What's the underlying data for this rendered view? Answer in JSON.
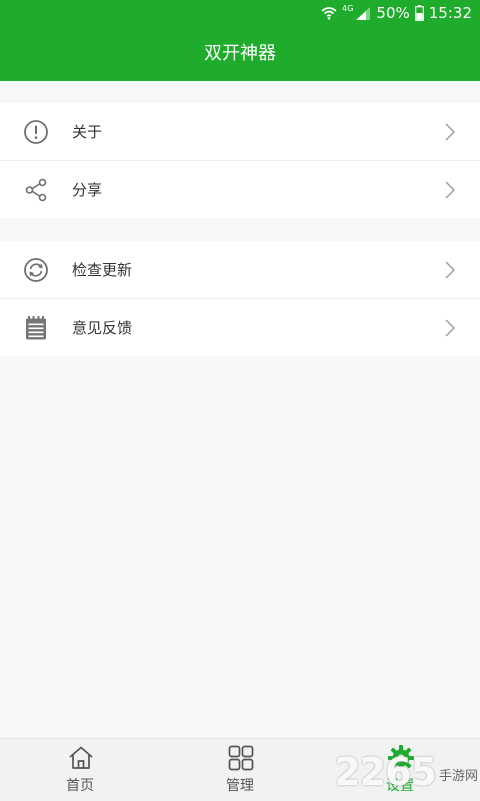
{
  "status_bar": {
    "network": "4G",
    "battery": "50%",
    "time": "15:32"
  },
  "header": {
    "title": "双开神器"
  },
  "menu_groups": [
    {
      "items": [
        {
          "label": "关于",
          "icon": "info-circle-icon"
        },
        {
          "label": "分享",
          "icon": "share-icon"
        }
      ]
    },
    {
      "items": [
        {
          "label": "检查更新",
          "icon": "refresh-icon"
        },
        {
          "label": "意见反馈",
          "icon": "notepad-icon"
        }
      ]
    }
  ],
  "tabs": [
    {
      "label": "首页",
      "icon": "home-icon"
    },
    {
      "label": "管理",
      "icon": "grid-icon"
    },
    {
      "label": "设置",
      "icon": "gear-icon",
      "active": true
    }
  ],
  "watermark": {
    "number": "2265",
    "text": "手游网"
  },
  "colors": {
    "brand": "#1fab2b",
    "background": "#f7f7f9",
    "icon_gray": "#6f6f6f"
  }
}
